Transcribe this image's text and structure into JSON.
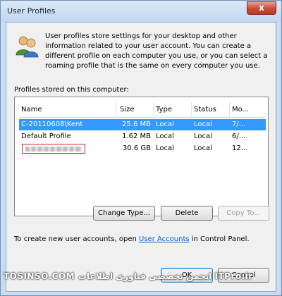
{
  "window": {
    "title": "User Profiles",
    "close_glyph": "x"
  },
  "intro_text": "User profiles store settings for your desktop and other information related to your user account. You can create a different profile on each computer you use, or you can select a roaming profile that is the same on every computer you use.",
  "list": {
    "caption": "Profiles stored on this computer:",
    "columns": [
      "Name",
      "Size",
      "Type",
      "Status",
      "Mo..."
    ],
    "rows": [
      {
        "name": "C-20110608\\Kent",
        "size": "25.6 MB",
        "type": "Local",
        "status": "Local",
        "modified": "7/...",
        "selected": true
      },
      {
        "name": "Default Profile",
        "size": "1.62 MB",
        "type": "Local",
        "status": "Local",
        "modified": "6/...",
        "selected": false
      },
      {
        "name": "",
        "size": "30.6 GB",
        "type": "Local",
        "status": "Local",
        "modified": "12...",
        "selected": false,
        "redacted": true
      }
    ]
  },
  "buttons": {
    "change_type": "Change Type...",
    "delete": "Delete",
    "copy_to": "Copy To...",
    "ok": "OK",
    "cancel": "Cancel"
  },
  "footer": {
    "prefix": "To create new user accounts, open ",
    "link": "User Accounts",
    "suffix": " in Control Panel."
  },
  "watermark": "TOSINSO.COM انجمن تخصصی فناوری اطلاعات ITPro.ir",
  "icons": {
    "profile": "users-icon"
  }
}
